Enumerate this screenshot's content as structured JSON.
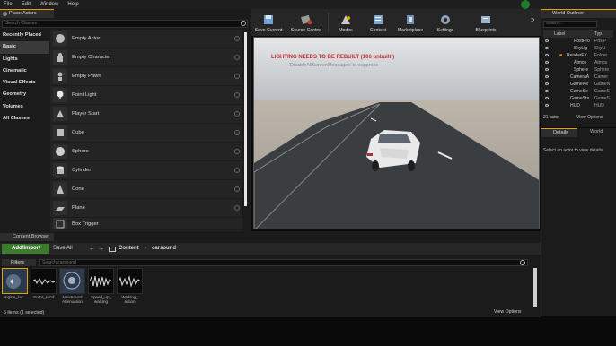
{
  "menu": {
    "items": [
      "File",
      "Edit",
      "Window",
      "Help"
    ]
  },
  "place_panel": {
    "tab_label": "Place Actors",
    "search_placeholder": "Search Classes",
    "categories": [
      "Recently Placed",
      "Basic",
      "Lights",
      "Cinematic",
      "Visual Effects",
      "Geometry",
      "Volumes",
      "All Classes"
    ],
    "active_category": "Basic",
    "actors": [
      "Empty Actor",
      "Empty Character",
      "Empty Pawn",
      "Point Light",
      "Player Start",
      "Cube",
      "Sphere",
      "Cylinder",
      "Cone",
      "Plane",
      "Box Trigger"
    ]
  },
  "toolbar": {
    "buttons": [
      "Save Current",
      "Source Control",
      "Modes",
      "Content",
      "Marketplace",
      "Settings",
      "Blueprints"
    ],
    "more": "»"
  },
  "viewport": {
    "warning": "LIGHTING NEEDS TO BE REBUILT (106 unbuilt )",
    "hint": "'DisableAllScreenMessages' to suppress"
  },
  "outliner": {
    "tab_label": "World Outliner",
    "search_placeholder": "Search...",
    "col_label": "Label",
    "col_type": "Typ",
    "rows": [
      {
        "label": "PostPro",
        "type": "PostP"
      },
      {
        "label": "SkyLig",
        "type": "SkyLi"
      },
      {
        "label": "RenderFX",
        "type": "Folder"
      },
      {
        "label": "Atmos",
        "type": "Atmos"
      },
      {
        "label": "Sphere",
        "type": "Sphere"
      },
      {
        "label": "CameraA",
        "type": "Camer"
      },
      {
        "label": "GameNe",
        "type": "GameN"
      },
      {
        "label": "GameSe",
        "type": "GameS"
      },
      {
        "label": "GameSta",
        "type": "GameS"
      },
      {
        "label": "HUD",
        "type": "HUD"
      }
    ],
    "actor_count": "21 actor",
    "view_options": "View Options"
  },
  "details": {
    "tab_label": "Details",
    "world_tab_label": "World",
    "hint": "Select an actor to view details."
  },
  "content_browser": {
    "tab_label": "Content Browser",
    "add_import": "Add/Import",
    "save_all": "Save All",
    "crumb_root": "Content",
    "crumb_sep": "›",
    "crumb_folder": "carsound",
    "filters": "Filters",
    "search_placeholder": "Search carsound",
    "assets": [
      "engine_loo...",
      "motor_sund",
      "NewSound Attenuation",
      "Speed_up_ walking",
      "Walking_ action"
    ],
    "status": "5 items (1 selected)",
    "view_options": "View Options"
  },
  "colors": {
    "accent": "#e2a300",
    "add_button": "#3c7a2e",
    "warning": "#c62f2f"
  },
  "icons": [
    "search-icon",
    "save-icon",
    "source-control-icon",
    "modes-icon",
    "content-icon",
    "marketplace-icon",
    "settings-icon",
    "blueprints-icon",
    "eye-icon",
    "folder-icon",
    "filter-icon",
    "info-icon"
  ]
}
